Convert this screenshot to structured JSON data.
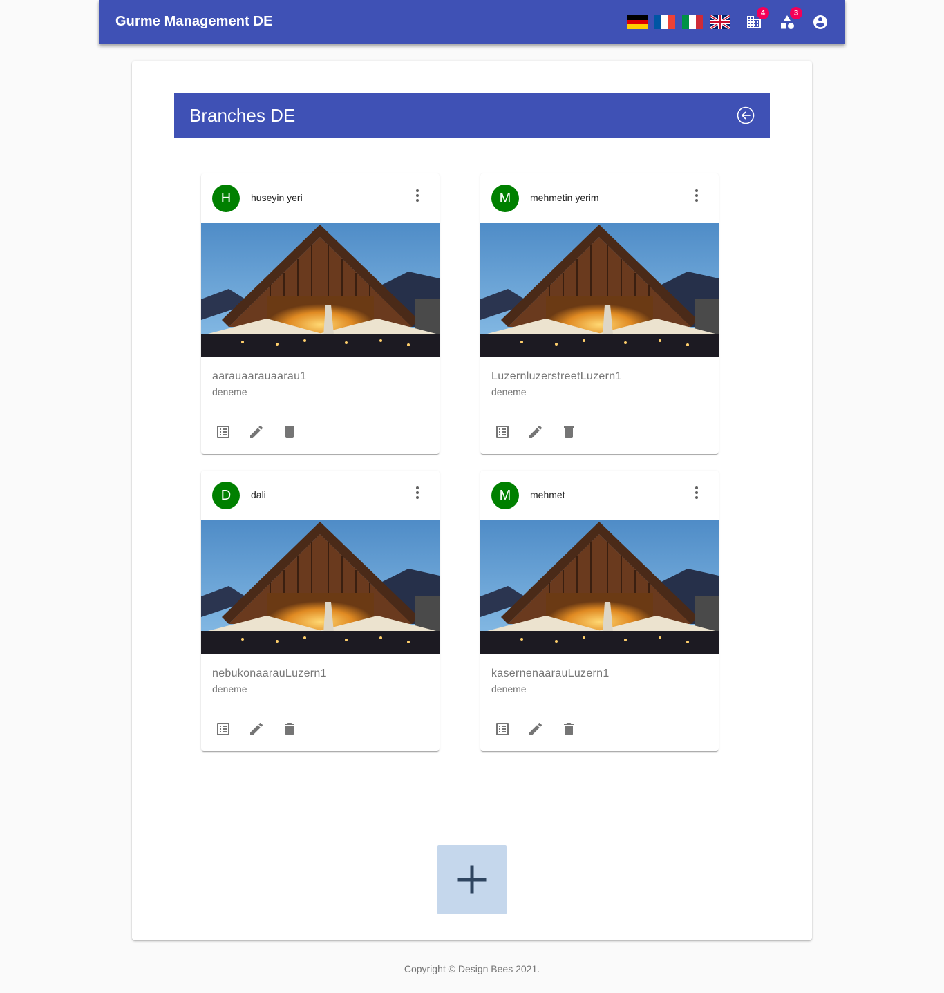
{
  "appbar": {
    "title": "Gurme Management DE",
    "flags": [
      "german-flag-icon",
      "french-flag-icon",
      "italian-flag-icon",
      "uk-flag-icon"
    ],
    "branches_badge": "4",
    "categories_badge": "3"
  },
  "page": {
    "title": "Branches DE"
  },
  "cards": [
    {
      "initial": "H",
      "name": "huseyin yeri",
      "address": "aarauaarauaarau1",
      "description": "deneme"
    },
    {
      "initial": "M",
      "name": "mehmetin yerim",
      "address": "LuzernluzerstreetLuzern1",
      "description": "deneme"
    },
    {
      "initial": "D",
      "name": "dali",
      "address": "nebukonaarauLuzern1",
      "description": "deneme"
    },
    {
      "initial": "M",
      "name": "mehmet",
      "address": "kasernenaarauLuzern1",
      "description": "deneme"
    }
  ],
  "footer": {
    "copyright": "Copyright © Design Bees 2021."
  },
  "colors": {
    "primary": "#3f51b5",
    "avatar": "#008000",
    "badge": "#f50057",
    "add_button": "#c5d7ec"
  }
}
